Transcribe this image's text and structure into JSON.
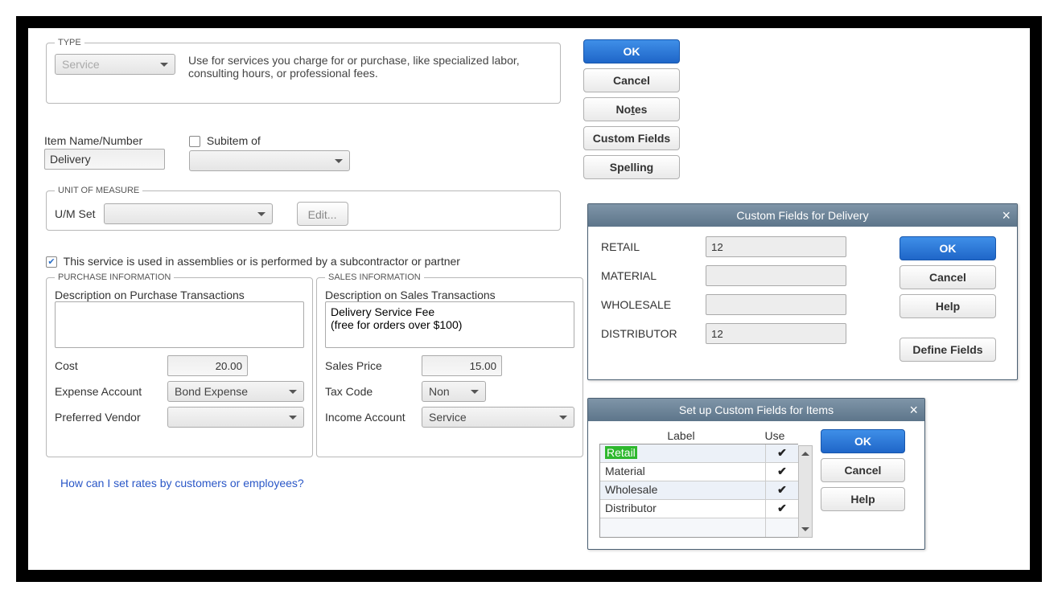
{
  "item": {
    "type_field": {
      "label": "TYPE",
      "value": "Service"
    },
    "type_desc": "Use for services you charge for or purchase, like specialized labor, consulting hours, or professional fees.",
    "name_label": "Item Name/Number",
    "name_value": "Delivery",
    "subitem_label": "Subitem of",
    "subitem_checked": false,
    "uom_section": "UNIT OF MEASURE",
    "uom_set_label": "U/M Set",
    "uom_edit": "Edit...",
    "assembly_checkbox_label": "This service is used in assemblies or is performed by a subcontractor or partner",
    "purchase_section": "PURCHASE INFORMATION",
    "purchase_desc_label": "Description on Purchase Transactions",
    "purchase_desc_value": "",
    "cost_label": "Cost",
    "cost_value": "20.00",
    "expense_label": "Expense Account",
    "expense_value": "Bond Expense",
    "vendor_label": "Preferred Vendor",
    "vendor_value": "",
    "sales_section": "SALES INFORMATION",
    "sales_desc_label": "Description on Sales Transactions",
    "sales_desc_value": "Delivery Service Fee\n(free for orders over $100)",
    "price_label": "Sales Price",
    "price_value": "15.00",
    "tax_label": "Tax Code",
    "tax_value": "Non",
    "income_label": "Income Account",
    "income_value": "Service",
    "rates_link": "How can I set rates by customers or employees?"
  },
  "buttons": {
    "ok": "OK",
    "cancel": "Cancel",
    "notes": "Notes",
    "custom_fields": "Custom Fields",
    "spelling": "Spelling",
    "help": "Help",
    "define_fields": "Define Fields"
  },
  "cf_popup": {
    "title": "Custom Fields for Delivery",
    "rows": [
      {
        "label": "RETAIL",
        "value": "12"
      },
      {
        "label": "MATERIAL",
        "value": ""
      },
      {
        "label": "WHOLESALE",
        "value": ""
      },
      {
        "label": "DISTRIBUTOR",
        "value": "12"
      }
    ]
  },
  "su_popup": {
    "title": "Set up Custom Fields for Items",
    "col_label": "Label",
    "col_use": "Use",
    "rows": [
      {
        "label": "Retail",
        "use": true,
        "selected": true
      },
      {
        "label": "Material",
        "use": true
      },
      {
        "label": "Wholesale",
        "use": true
      },
      {
        "label": "Distributor",
        "use": true
      },
      {
        "label": "",
        "use": false
      }
    ]
  }
}
